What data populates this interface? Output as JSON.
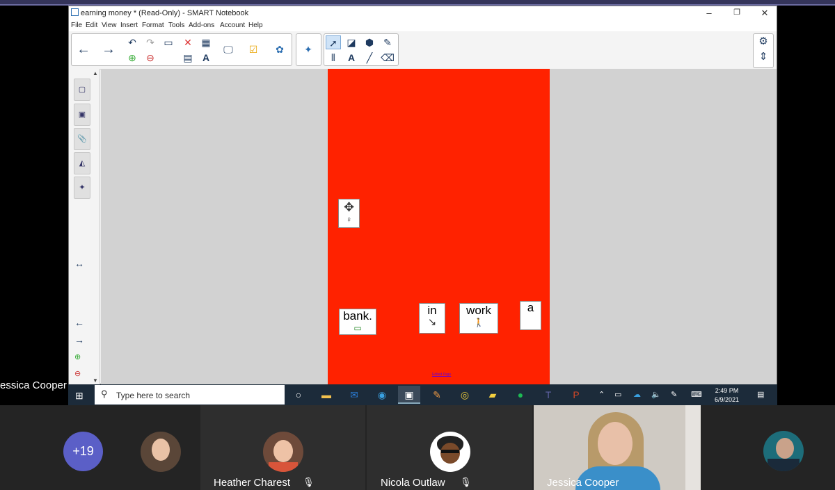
{
  "window": {
    "title": "earning money * (Read-Only) - SMART Notebook",
    "controls": [
      "–",
      "❐",
      "✕"
    ]
  },
  "menu": [
    "File",
    "Edit",
    "View",
    "Insert",
    "Format",
    "Tools",
    "Add-ons",
    "Account",
    "Help"
  ],
  "toolbar": {
    "back": "←",
    "forward": "→",
    "undo": "↶",
    "redo": "↷",
    "text_tool": "A"
  },
  "page_cards": {
    "bank": "bank.",
    "in": "in",
    "work": "work",
    "a": "a"
  },
  "page_footer": "Edited Page",
  "taskbar": {
    "search_placeholder": "Type here to search",
    "time": "2:49 PM",
    "date": "6/9/2021"
  },
  "meeting": {
    "overflow_count": "+19",
    "active_speaker_label": "essica Cooper",
    "participants": [
      {
        "name": "Heather Charest"
      },
      {
        "name": "Nicola Outlaw"
      },
      {
        "name": "Jessica Cooper"
      }
    ]
  },
  "colors": {
    "page_red": "#ff2200",
    "teams_purple": "#5b5fc7",
    "taskbar": "#1c2b3a"
  }
}
